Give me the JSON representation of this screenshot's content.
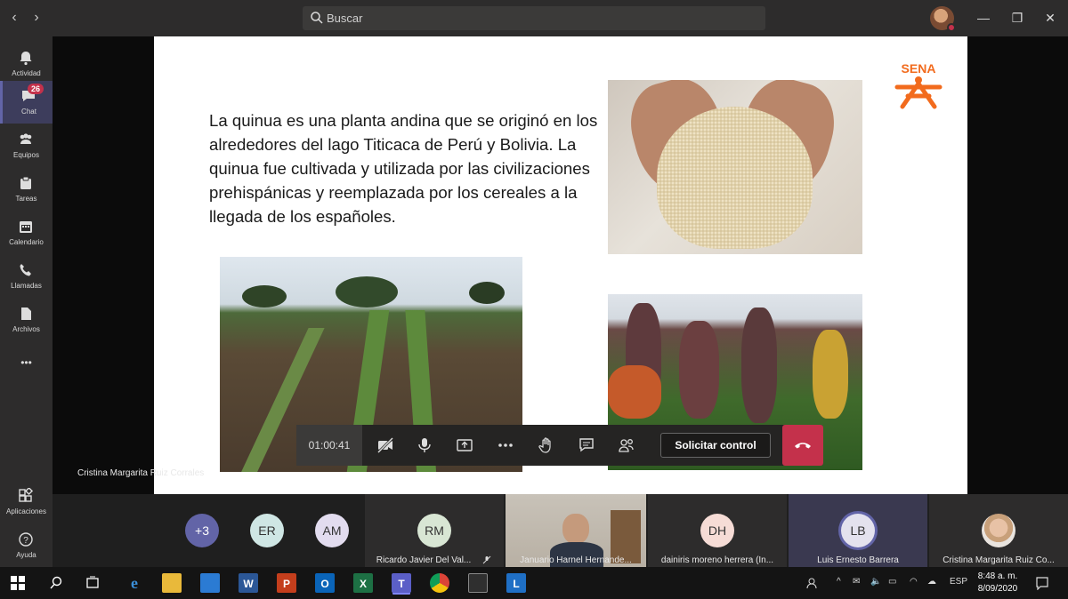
{
  "titlebar": {
    "search_placeholder": "Buscar"
  },
  "rail": {
    "items": [
      {
        "label": "Actividad",
        "icon": "bell-icon"
      },
      {
        "label": "Chat",
        "icon": "chat-icon",
        "badge": "26"
      },
      {
        "label": "Equipos",
        "icon": "teams-icon"
      },
      {
        "label": "Tareas",
        "icon": "tasks-icon"
      },
      {
        "label": "Calendario",
        "icon": "calendar-icon"
      },
      {
        "label": "Llamadas",
        "icon": "phone-icon"
      },
      {
        "label": "Archivos",
        "icon": "files-icon"
      }
    ],
    "more": "•••",
    "apps_label": "Aplicaciones",
    "help_label": "Ayuda"
  },
  "slide": {
    "text": "La quinua es una planta andina que se originó en los alrededores del lago Titicaca de Perú y Bolivia. La quinua fue cultivada y utilizada por las civilizaciones prehispánicas y reemplazada por los cereales a la llegada de los españoles.",
    "logo_text": "SENA"
  },
  "presenter": {
    "name": "Cristina Margarita Ruiz Corrales"
  },
  "controls": {
    "timer": "01:00:41",
    "request_control": "Solicitar control"
  },
  "participants": {
    "overflow": "+3",
    "circles": [
      "ER",
      "AM"
    ],
    "tiles": [
      {
        "initials": "RM",
        "name": "Ricardo Javier Del Val..."
      },
      {
        "initials": "",
        "name": "Januario Harnel Hernande..."
      },
      {
        "initials": "DH",
        "name": "dainiris moreno herrera (In..."
      },
      {
        "initials": "LB",
        "name": "Luis Ernesto Barrera"
      },
      {
        "initials": "",
        "name": "Cristina Margarita Ruiz Co..."
      }
    ]
  },
  "taskbar": {
    "lang": "ESP",
    "time": "8:48 a. m.",
    "date": "8/09/2020"
  },
  "colors": {
    "accent": "#6264a7",
    "hangup": "#c4314b",
    "sena_orange": "#f26b1d"
  }
}
